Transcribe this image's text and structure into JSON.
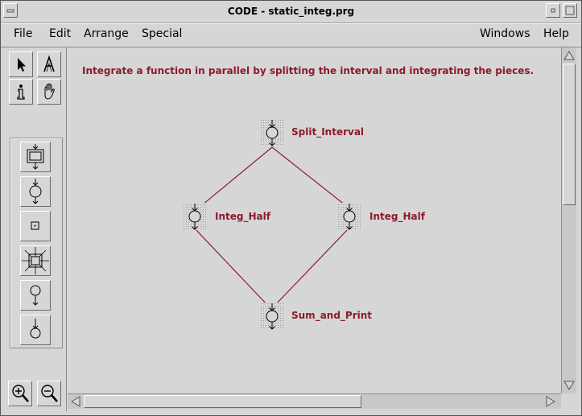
{
  "window": {
    "title": "CODE - static_integ.prg"
  },
  "menubar": {
    "left": [
      "File",
      "Edit",
      "Arrange",
      "Special"
    ],
    "right": [
      "Windows",
      "Help"
    ]
  },
  "palette": {
    "top_tools": [
      "pointer-icon",
      "text-tool-icon",
      "info-icon",
      "hand-icon"
    ],
    "node_tools": [
      "call-node-icon",
      "compute-node-icon",
      "comment-node-icon",
      "create-node-icon",
      "input-port-icon",
      "output-port-icon"
    ],
    "zoom_tools": [
      "zoom-in-icon",
      "zoom-out-icon"
    ]
  },
  "canvas": {
    "description": "Integrate a function in parallel by splitting the interval and integrating the pieces.",
    "nodes": [
      {
        "id": "split",
        "label": "Split_Interval"
      },
      {
        "id": "left",
        "label": "Integ_Half"
      },
      {
        "id": "right",
        "label": "Integ_Half"
      },
      {
        "id": "sum",
        "label": "Sum_and_Print"
      }
    ],
    "arcs": [
      [
        "split",
        "left"
      ],
      [
        "split",
        "right"
      ],
      [
        "left",
        "sum"
      ],
      [
        "right",
        "sum"
      ]
    ]
  },
  "colors": {
    "graph": "#8b1a2e",
    "background": "#d6d6d6"
  }
}
